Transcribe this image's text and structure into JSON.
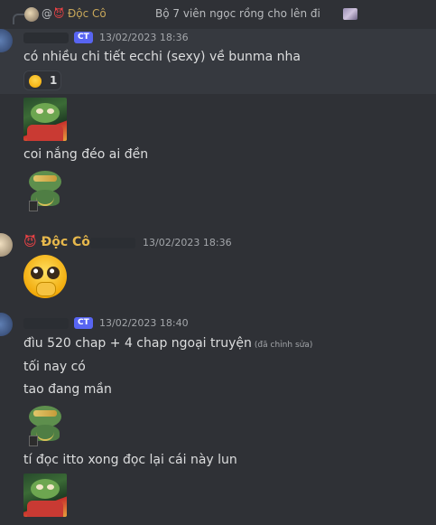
{
  "reply_bar": {
    "at_sign": "@",
    "devil_icon": "😈",
    "author": "Độc Cô",
    "text": "Bộ 7 viên ngọc rồng cho lên đi"
  },
  "messages": {
    "group1": {
      "badge": "CT",
      "timestamp": "13/02/2023 18:36",
      "line1": "có nhiều chi tiết ecchi (sexy) về bunma nha",
      "reaction_count": "1",
      "line2": "coi nắng đéo ai đền"
    },
    "group2": {
      "devil_icon": "😈",
      "author": "Độc Cô",
      "timestamp": "13/02/2023 18:36"
    },
    "group3": {
      "badge": "CT",
      "timestamp": "13/02/2023 18:40",
      "line1": "đìu 520 chap + 4 chap ngoại truyện",
      "edited": "(đã chỉnh sửa)",
      "line2": "tối nay có",
      "line3": "tao đang mần",
      "line4": "tí đọc itto xong đọc lại cái này lun"
    }
  },
  "colors": {
    "background": "#2f3136",
    "highlight": "#36393f",
    "badge": "#5865f2",
    "author_gold": "#e7b84c",
    "text": "#dcddde"
  },
  "icons": {
    "reply_avatar": "user-avatar",
    "reply_emoji": "custom-emoji-icon",
    "reaction": "shy-face-emoji-icon",
    "sticker_chill": "pepe-chill-emoji",
    "sticker_rich": "pepe-rich-emoji",
    "pleading": "pleading-face-emoji"
  }
}
